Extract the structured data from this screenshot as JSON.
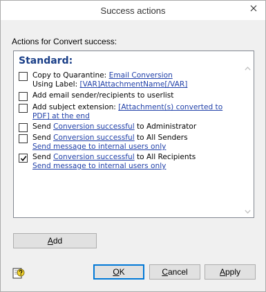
{
  "window": {
    "title": "Success actions",
    "close_icon": "close-icon"
  },
  "group_label": "Actions for Convert success:",
  "section_title": "Standard:",
  "actions": [
    {
      "checked": false,
      "line1_prefix": "Copy to Quarantine: ",
      "line1_link": "Email Conversion",
      "line2_prefix": "Using Label: ",
      "line2_link": "[VAR]AttachmentName[/VAR]"
    },
    {
      "checked": false,
      "text": "Add email sender/recipients to userlist"
    },
    {
      "checked": false,
      "line1_prefix": "Add subject extension: ",
      "line1_link": "[Attachment(s) converted to",
      "line2_link": "PDF]",
      "line2_suffix": " at the end"
    },
    {
      "checked": false,
      "prefix": "Send ",
      "link": "Conversion successful",
      "suffix": " to Administrator"
    },
    {
      "checked": false,
      "prefix": "Send ",
      "link": "Conversion successful",
      "suffix": " to All Senders",
      "line2_link": "Send message to internal users only"
    },
    {
      "checked": true,
      "prefix": "Send ",
      "link": "Conversion successful",
      "suffix": " to All Recipients",
      "line2_link": "Send message to internal users only"
    }
  ],
  "buttons": {
    "add_first": "A",
    "add_rest": "dd",
    "ok_first": "O",
    "ok_rest": "K",
    "cancel_first": "C",
    "cancel_rest": "ancel",
    "apply_first": "A",
    "apply_rest": "pply"
  },
  "icons": {
    "help": "help-icon",
    "scroll_up": "scroll-up-icon",
    "scroll_down": "scroll-down-icon",
    "checkmark": "checkmark-icon"
  }
}
